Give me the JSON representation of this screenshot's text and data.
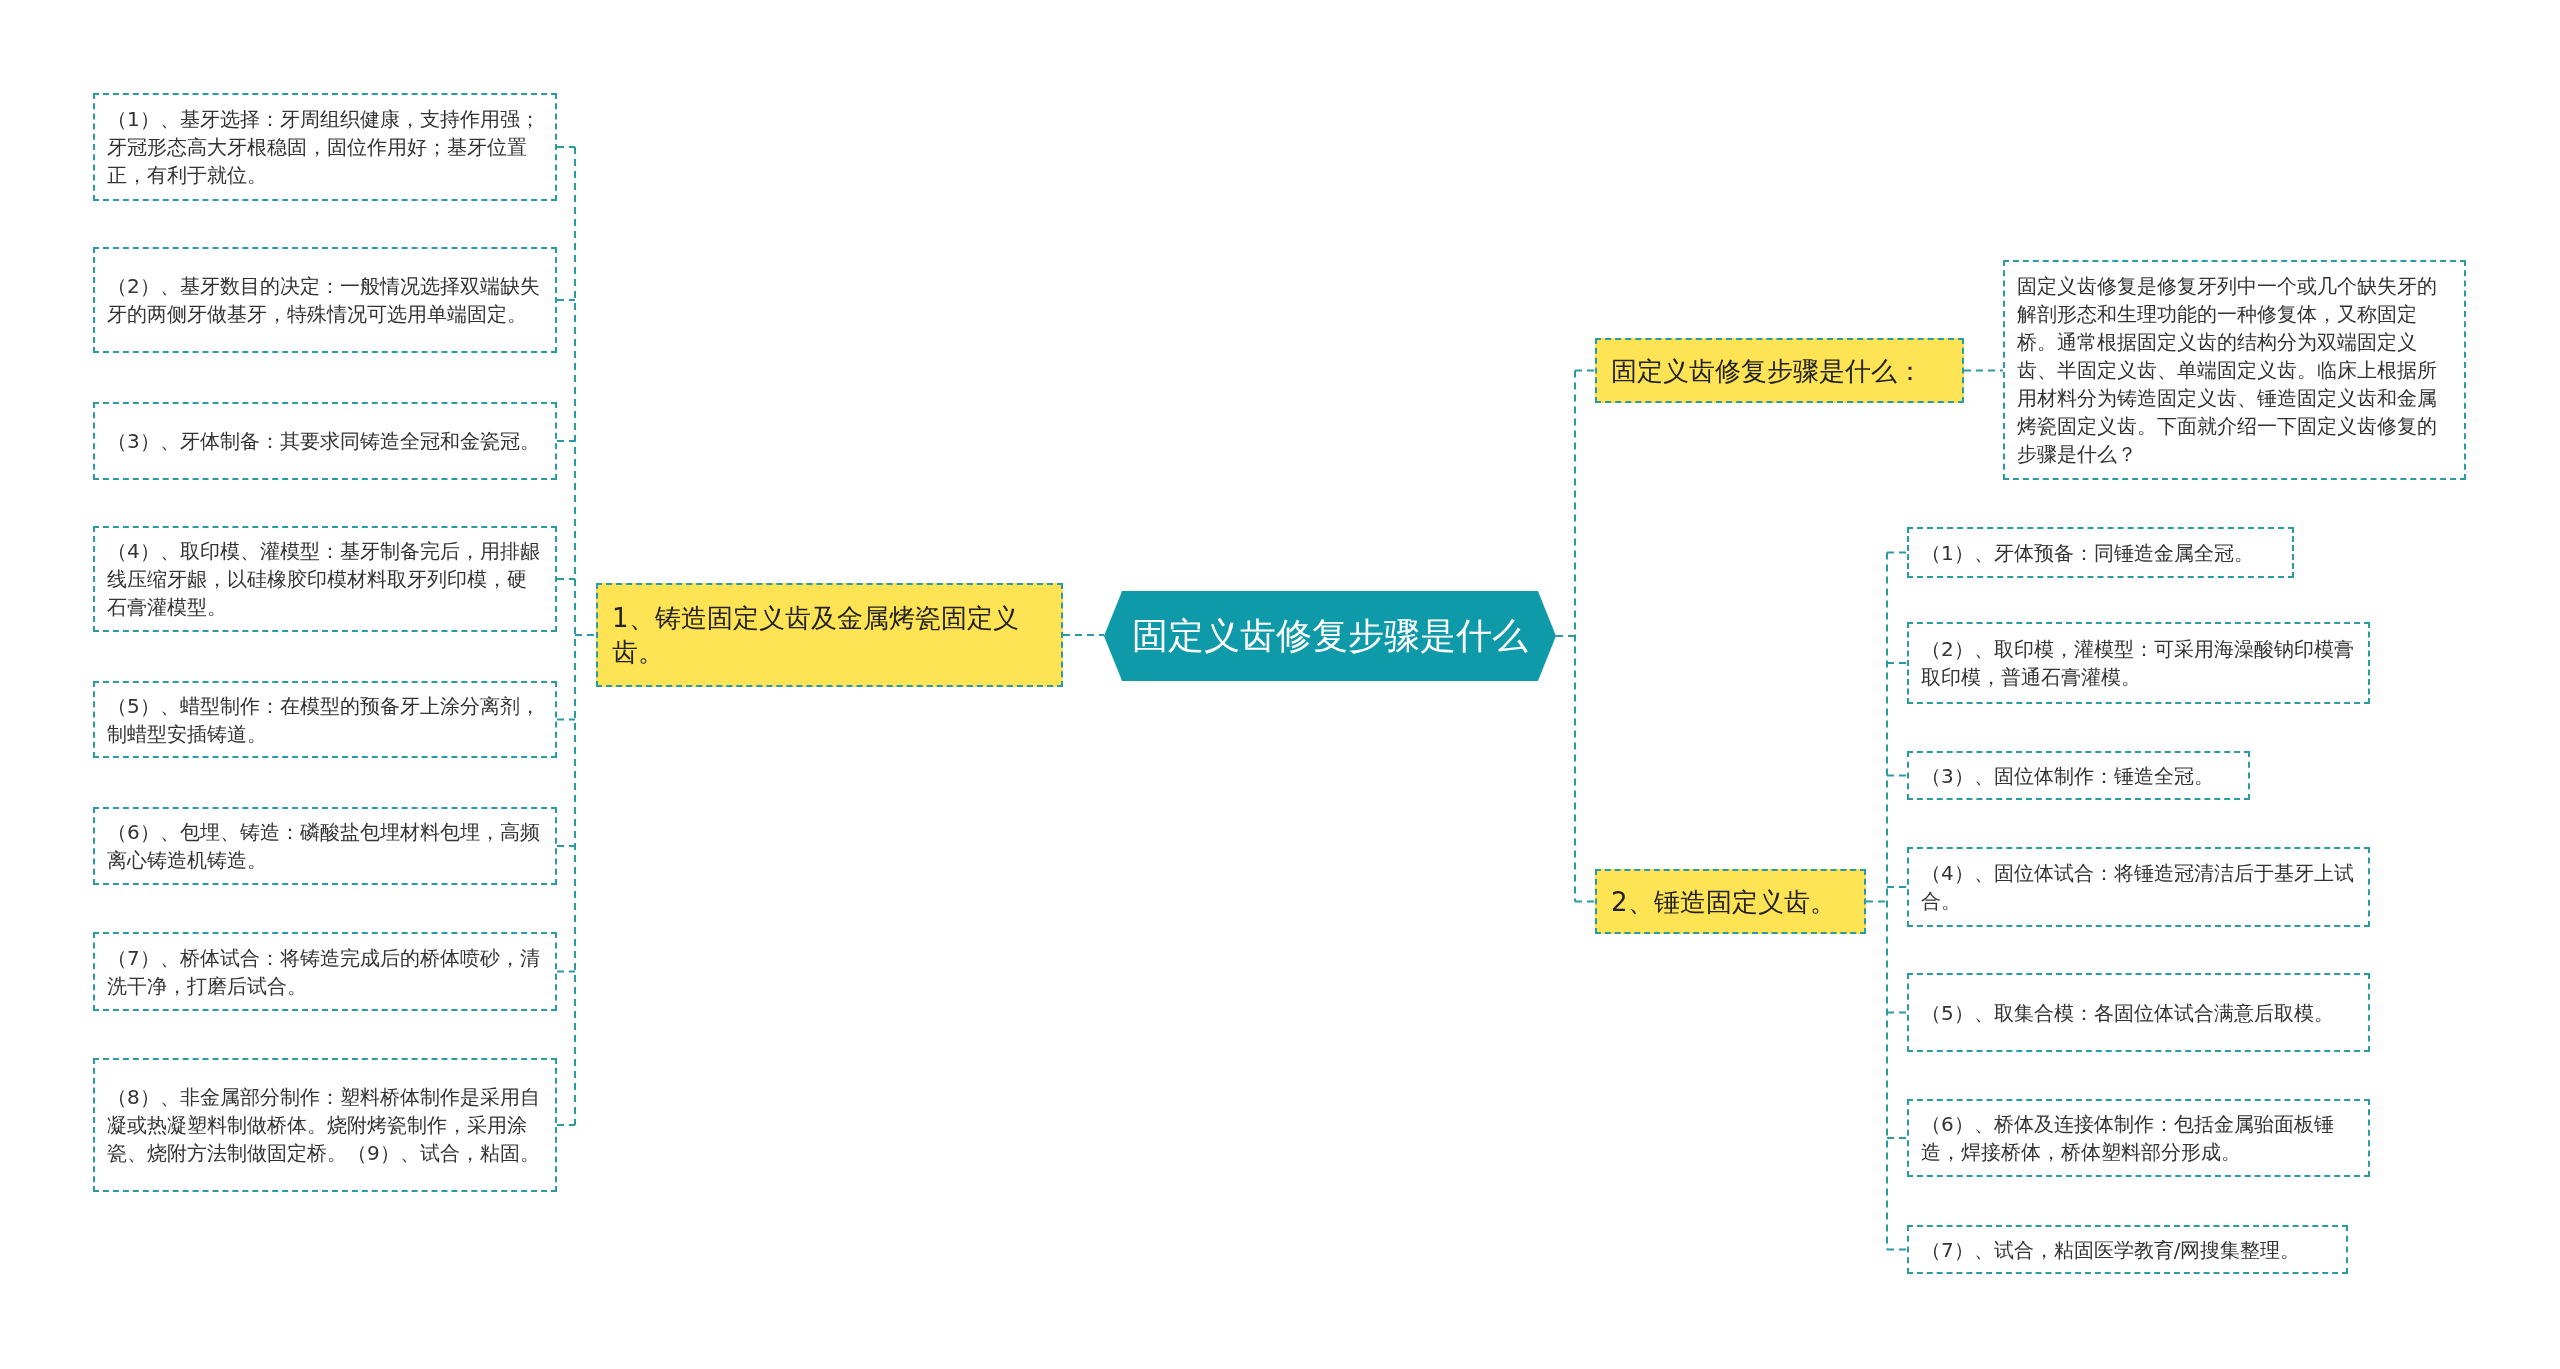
{
  "root": {
    "title": "固定义齿修复步骤是什么"
  },
  "branches": [
    {
      "title": "1、铸造固定义齿及金属烤瓷固定义齿。",
      "children": [
        {
          "text": "（1）、基牙选择：牙周组织健康，支持作用强；牙冠形态高大牙根稳固，固位作用好；基牙位置正，有利于就位。"
        },
        {
          "text": "（2）、基牙数目的决定：一般情况选择双端缺失牙的两侧牙做基牙，特殊情况可选用单端固定。"
        },
        {
          "text": "（3）、牙体制备：其要求同铸造全冠和金瓷冠。"
        },
        {
          "text": "（4）、取印模、灌模型：基牙制备完后，用排龈线压缩牙龈，以硅橡胶印模材料取牙列印模，硬石膏灌模型。"
        },
        {
          "text": "（5）、蜡型制作：在模型的预备牙上涂分离剂，制蜡型安插铸道。"
        },
        {
          "text": "（6）、包埋、铸造：磷酸盐包埋材料包埋，高频离心铸造机铸造。"
        },
        {
          "text": "（7）、桥体试合：将铸造完成后的桥体喷砂，清洗干净，打磨后试合。"
        },
        {
          "text": "（8）、非金属部分制作：塑料桥体制作是采用自凝或热凝塑料制做桥体。烧附烤瓷制作，采用涂瓷、烧附方法制做固定桥。（9）、试合，粘固。"
        }
      ]
    },
    {
      "title": "固定义齿修复步骤是什么：",
      "children": [
        {
          "text": "固定义齿修复是修复牙列中一个或几个缺失牙的解剖形态和生理功能的一种修复体，又称固定桥。通常根据固定义齿的结构分为双端固定义齿、半固定义齿、单端固定义齿。临床上根据所用材料分为铸造固定义齿、锤造固定义齿和金属烤瓷固定义齿。下面就介绍一下固定义齿修复的步骤是什么？"
        }
      ]
    },
    {
      "title": "2、锤造固定义齿。",
      "children": [
        {
          "text": "（1）、牙体预备：同锤造金属全冠。"
        },
        {
          "text": "（2）、取印模，灌模型：可采用海澡酸钠印模膏取印模，普通石膏灌模。"
        },
        {
          "text": "（3）、固位体制作：锤造全冠。"
        },
        {
          "text": "（4）、固位体试合：将锤造冠清洁后于基牙上试合。"
        },
        {
          "text": "（5）、取集合模：各固位体试合满意后取模。"
        },
        {
          "text": "（6）、桥体及连接体制作：包括金属骀面板锤造，焊接桥体，桥体塑料部分形成。"
        },
        {
          "text": "（7）、试合，粘固医学教育/网搜集整理。"
        }
      ]
    }
  ]
}
